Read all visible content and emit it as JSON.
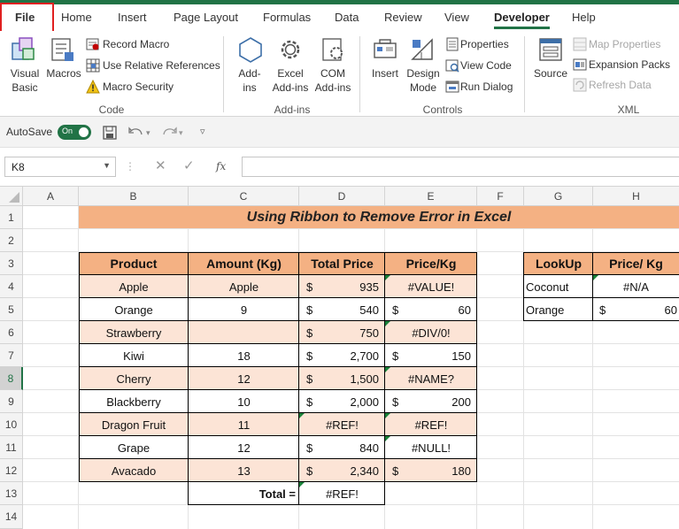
{
  "tabs": [
    "File",
    "Home",
    "Insert",
    "Page Layout",
    "Formulas",
    "Data",
    "Review",
    "View",
    "Developer",
    "Help"
  ],
  "active_tab": "Developer",
  "ribbon": {
    "code": {
      "label": "Code",
      "visual_basic": [
        "Visual",
        "Basic"
      ],
      "macros": "Macros",
      "record_macro": "Record Macro",
      "use_relative": "Use Relative References",
      "macro_security": "Macro Security"
    },
    "addins": {
      "label": "Add-ins",
      "addins_btn": [
        "Add-",
        "ins"
      ],
      "excel_addins": [
        "Excel",
        "Add-ins"
      ],
      "com_addins": [
        "COM",
        "Add-ins"
      ]
    },
    "controls": {
      "label": "Controls",
      "insert": "Insert",
      "design_mode": [
        "Design",
        "Mode"
      ],
      "properties": "Properties",
      "view_code": "View Code",
      "run_dialog": "Run Dialog"
    },
    "xml": {
      "label": "XML",
      "source": "Source",
      "map_properties": "Map Properties",
      "expansion_packs": "Expansion Packs",
      "refresh_data": "Refresh Data"
    }
  },
  "qat": {
    "autosave_label": "AutoSave",
    "autosave_state": "On"
  },
  "formula_bar": {
    "name_box": "K8",
    "fx": "fx",
    "formula": ""
  },
  "columns": [
    "A",
    "B",
    "C",
    "D",
    "E",
    "F",
    "G",
    "H"
  ],
  "rows": [
    "1",
    "2",
    "3",
    "4",
    "5",
    "6",
    "7",
    "8",
    "9",
    "10",
    "11",
    "12",
    "13",
    "14"
  ],
  "selected_row": "8",
  "sheet": {
    "title": "Using Ribbon to Remove Error in Excel",
    "headers": [
      "Product",
      "Amount (Kg)",
      "Total Price",
      "Price/Kg"
    ],
    "data": [
      {
        "product": "Apple",
        "amount": "Apple",
        "total_cur": "$",
        "total": "935",
        "price_cur": "",
        "price": "#VALUE!"
      },
      {
        "product": "Orange",
        "amount": "9",
        "total_cur": "$",
        "total": "540",
        "price_cur": "$",
        "price": "60"
      },
      {
        "product": "Strawberry",
        "amount": "",
        "total_cur": "$",
        "total": "750",
        "price_cur": "",
        "price": "#DIV/0!"
      },
      {
        "product": "Kiwi",
        "amount": "18",
        "total_cur": "$",
        "total": "2,700",
        "price_cur": "$",
        "price": "150"
      },
      {
        "product": "Cherry",
        "amount": "12",
        "total_cur": "$",
        "total": "1,500",
        "price_cur": "",
        "price": "#NAME?"
      },
      {
        "product": "Blackberry",
        "amount": "10",
        "total_cur": "$",
        "total": "2,000",
        "price_cur": "$",
        "price": "200"
      },
      {
        "product": "Dragon Fruit",
        "amount": "11",
        "total_cur": "",
        "total": "#REF!",
        "price_cur": "",
        "price": "#REF!"
      },
      {
        "product": "Grape",
        "amount": "12",
        "total_cur": "$",
        "total": "840",
        "price_cur": "",
        "price": "#NULL!"
      },
      {
        "product": "Avacado",
        "amount": "13",
        "total_cur": "$",
        "total": "2,340",
        "price_cur": "$",
        "price": "180"
      }
    ],
    "total_label": "Total =",
    "total_value": "#REF!",
    "lookup_headers": [
      "LookUp",
      "Price/ Kg"
    ],
    "lookup_rows": [
      {
        "item": "Coconut",
        "cur": "",
        "value": "#N/A"
      },
      {
        "item": "Orange",
        "cur": "$",
        "value": "60"
      }
    ]
  },
  "colors": {
    "accent": "#217346",
    "header_fill": "#f4b183",
    "band_fill": "#fce4d6",
    "highlight": "#e02020",
    "error_flag": "#188038"
  }
}
